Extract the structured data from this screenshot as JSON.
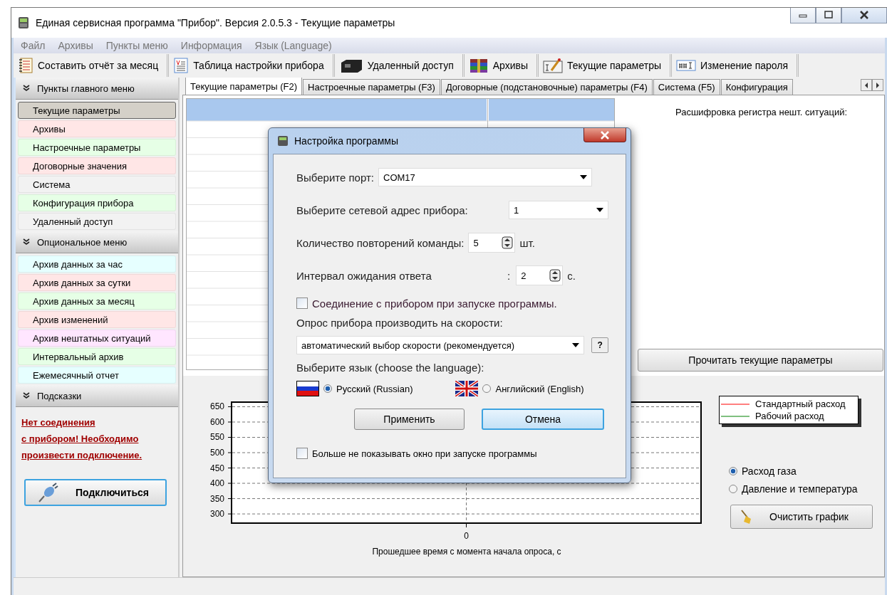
{
  "window": {
    "title": "Единая сервисная программа \"Прибор\".   Версия 2.0.5.3 - Текущие параметры"
  },
  "menu": [
    "Файл",
    "Архивы",
    "Пункты меню",
    "Информация",
    "Язык (Language)"
  ],
  "toolbar": [
    {
      "label": "Составить отчёт за месяц",
      "kind": "notebook"
    },
    {
      "label": "Таблица настройки прибора",
      "kind": "document"
    },
    {
      "label": "Удаленный доступ",
      "kind": "device"
    },
    {
      "label": "Архивы",
      "kind": "books"
    },
    {
      "label": "Текущие параметры",
      "kind": "pencil"
    },
    {
      "label": "Изменение пароля",
      "kind": "password"
    }
  ],
  "tabs": [
    {
      "label": "Текущие параметры (F2)",
      "selected": true
    },
    {
      "label": "Настроечные параметры (F3)",
      "selected": false
    },
    {
      "label": "Договорные (подстановочные) параметры (F4)",
      "selected": false
    },
    {
      "label": "Система (F5)",
      "selected": false
    },
    {
      "label": "Конфигурация",
      "selected": false
    }
  ],
  "sidebar": {
    "sections": [
      {
        "title": "Пункты главного меню",
        "kind": "list",
        "items": [
          {
            "label": "Текущие параметры",
            "color": "#d4d0c8",
            "selected": true
          },
          {
            "label": "Архивы",
            "color": "#ffe6e6",
            "selected": false
          },
          {
            "label": "Настроечные параметры",
            "color": "#e6ffe6",
            "selected": false
          },
          {
            "label": "Договорные значения",
            "color": "#ffe6e6",
            "selected": false
          },
          {
            "label": "Система",
            "color": "#f2f2f2",
            "selected": false
          },
          {
            "label": "Конфигурация прибора",
            "color": "#e6ffe6",
            "selected": false
          },
          {
            "label": "Удаленный доступ",
            "color": "#f2f2f2",
            "selected": false
          }
        ]
      },
      {
        "title": "Опциональное меню",
        "kind": "list",
        "items": [
          {
            "label": "Архив данных за час",
            "color": "#e6ffff",
            "selected": false
          },
          {
            "label": "Архив данных за сутки",
            "color": "#ffe6e6",
            "selected": false
          },
          {
            "label": "Архив данных за месяц",
            "color": "#e6ffe6",
            "selected": false
          },
          {
            "label": "Архив изменений",
            "color": "#ffe6e6",
            "selected": false
          },
          {
            "label": "Архив нештатных ситуаций",
            "color": "#ffe6ff",
            "selected": false
          },
          {
            "label": "Интервальный архив",
            "color": "#e6ffe6",
            "selected": false
          },
          {
            "label": "Ежемесячный отчет",
            "color": "#e6ffff",
            "selected": false
          }
        ]
      },
      {
        "title": "Подсказки",
        "kind": "hints",
        "lines": [
          "Нет соединения",
          "с прибором! Необходимо",
          "произвести подключение."
        ],
        "button": "Подключиться"
      }
    ]
  },
  "register_panel": {
    "title": "Расшифровка регистра нешт. ситуаций:",
    "button": "Прочитать текущие параметры"
  },
  "chart": {
    "chart_data": {
      "type": "line",
      "xlabel": "Прошедшее время с момента начала опроса, с",
      "categories": [
        "0"
      ],
      "ylim": [
        270,
        665
      ],
      "yticks": [
        300,
        350,
        400,
        450,
        500,
        550,
        600,
        650
      ],
      "grid": true,
      "series": [
        {
          "name": "Стандартный расход",
          "color": "#ff0000",
          "values": [
            null
          ]
        },
        {
          "name": "Рабочий расход",
          "color": "#008000",
          "values": [
            null
          ]
        }
      ]
    }
  },
  "chart_options": [
    {
      "label": "Расход газа",
      "selected": true
    },
    {
      "label": "Давление и температура",
      "selected": false
    }
  ],
  "clear_button": "Очистить график",
  "dialog": {
    "title": "Настройка программы",
    "port": {
      "label": "Выберите порт:",
      "value": "COM17"
    },
    "address": {
      "label": "Выберите сетевой адрес прибора:",
      "value": "1"
    },
    "repeats": {
      "label": "Количество повторений команды:",
      "value": "5",
      "unit": "шт."
    },
    "interval": {
      "label": "Интервал ожидания ответа",
      "separator": ":",
      "value": "2",
      "unit": "с."
    },
    "connect_on_start": {
      "label": "Соединение с прибором при запуске программы.",
      "checked": false
    },
    "speed": {
      "label": "Опрос прибора производить на скорости:",
      "value": "автоматический выбор скорости (рекомендуется)",
      "help": "?"
    },
    "language": {
      "label": "Выберите язык (choose the language):",
      "options": [
        {
          "label": "Русский (Russian)",
          "kind": "ru",
          "selected": true
        },
        {
          "label": "Английский (English)",
          "kind": "en",
          "selected": false
        }
      ]
    },
    "buttons": [
      {
        "label": "Применить",
        "focused": false
      },
      {
        "label": "Отмена",
        "focused": true
      }
    ],
    "dont_show": {
      "label": "Больше не показывать окно при запуске  программы",
      "checked": false
    }
  }
}
